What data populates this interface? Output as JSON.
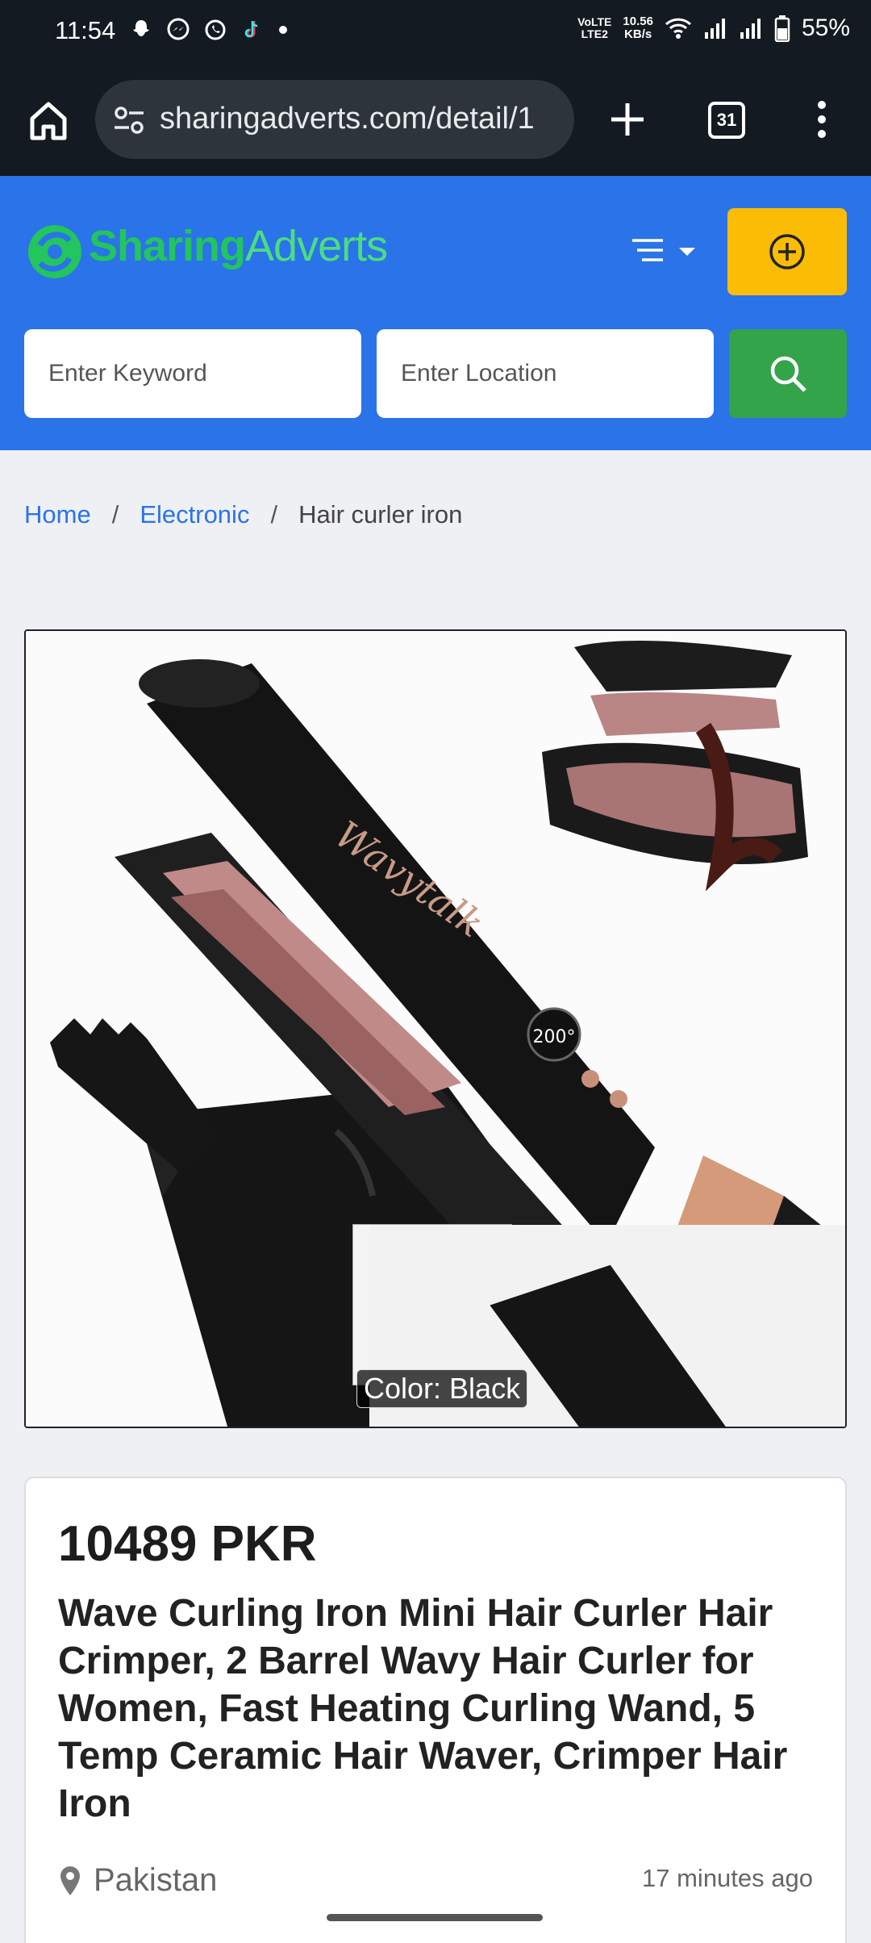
{
  "status_bar": {
    "time": "11:54",
    "net_type_top": "VoLTE",
    "net_type_bottom": "LTE2",
    "net_speed_value": "10.56",
    "net_speed_unit": "KB/s",
    "battery": "55%",
    "icons": [
      "snapchat-icon",
      "messenger-icon",
      "whatsapp-icon",
      "tiktok-icon",
      "dot-icon",
      "wifi-icon",
      "signal-icon",
      "signal-icon",
      "battery-icon"
    ]
  },
  "browser": {
    "url": "sharingadverts.com/detail/1",
    "tab_count": "31"
  },
  "header": {
    "logo_part1": "Sharing",
    "logo_part2": "Adverts",
    "brand_color": "#2b73e8",
    "post_button_color": "#fbbc05",
    "search_button_color": "#34a44a"
  },
  "search": {
    "keyword_placeholder": "Enter Keyword",
    "location_placeholder": "Enter Location"
  },
  "breadcrumb": {
    "home": "Home",
    "category": "Electronic",
    "current": "Hair curler iron",
    "separator": "/"
  },
  "gallery": {
    "brand_on_product": "Wavytalk",
    "temperature_display": "200°",
    "thumbnail_caption": "Color: Black"
  },
  "listing": {
    "price": "10489 PKR",
    "title": "Wave Curling Iron Mini Hair Curler Hair Crimper, 2 Barrel Wavy Hair Curler for Women, Fast Heating Curling Wand, 5 Temp Ceramic Hair Waver, Crimper Hair Iron",
    "location": "Pakistan",
    "posted": "17 minutes ago"
  }
}
